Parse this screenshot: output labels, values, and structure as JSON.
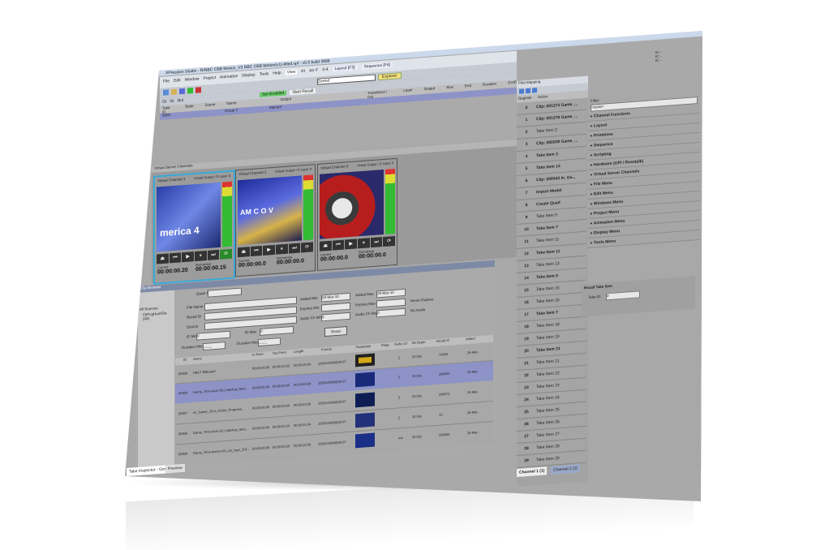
{
  "window": {
    "title": "XPression Studio - R/NBC CBB Motion_V3 NBC CBB Motion(v1)-titled.xpf - v5.5 build 3999",
    "controls": [
      "–",
      "□",
      "✕"
    ]
  },
  "menu": [
    "File",
    "Edit",
    "Window",
    "Project",
    "Animation",
    "Display",
    "Tools",
    "Help"
  ],
  "topbar": {
    "view_tabs": [
      "View",
      "Kt",
      "Arr F",
      "3-4"
    ],
    "layout_tab": "Layout [F3]",
    "sequence_tab": "Sequence [F4]",
    "scene_select": "Zeend",
    "explorer_button": "Explorer",
    "right_labels": [
      "IC -",
      "IC -",
      "IC -"
    ]
  },
  "sequencer": {
    "toolbar_labels": [
      "Gt",
      "Gt",
      "Dul",
      "Set Enabled",
      "Start Recall"
    ],
    "columns": [
      "Take ID",
      "State",
      "Scene",
      "Name",
      "Output",
      "Transitions / Out",
      "Layer",
      "Output",
      "Size",
      "End",
      "Duration",
      "GVID"
    ],
    "extra_label": "entries: 0",
    "rows": [
      {
        "id": "0000",
        "name": "Group 1",
        "output": "Manual"
      }
    ]
  },
  "virtual_channels": {
    "header": "Virtual Server Channels",
    "channels": [
      {
        "name": "Virtual Channel 1",
        "output": "Virtual Output I D Layer 0",
        "current_label": "Current",
        "current": "00:00:00.20",
        "remaining_label": "Remaining",
        "remaining": "00:00:00.15",
        "video_text": "merica 4"
      },
      {
        "name": "Virtual Channel 2",
        "output": "Virtual Output I D Layer 0",
        "current_label": "Current",
        "current": "00:00:00.0",
        "remaining_label": "Remaining",
        "remaining": "00:00:00.0",
        "video_text": "AM C O V"
      },
      {
        "name": "Virtual Channel 3",
        "output": "Virtual Output I D Layer 0",
        "current_label": "Current",
        "current": "00:00:00.0",
        "remaining_label": "Remaining",
        "remaining": "00:00:00.0",
        "video_text": ""
      }
    ]
  },
  "clip_browser": {
    "header": "Clip Browser",
    "tree": [
      "All Sources",
      "CliPcgHumFile (All)"
    ],
    "quick_find_label": "Quick Find",
    "filters": {
      "file_name": "File Name",
      "recall_id": "Recall ID",
      "source": "Source",
      "id_min": "ID Min",
      "id_max": "ID Max",
      "duration_min": "Duration Min",
      "duration_max": "Duration Max",
      "added_min": "Added Min",
      "added_min_val": "03-Mar-10",
      "added_max": "Added Max",
      "added_max_val": "28-Mar-10",
      "expires_min": "Expires Min",
      "expires_max": "Expires Max",
      "audio_ch_min": "Audio Ch Min",
      "audio_ch_max": "Audio Ch Max",
      "never_expires": "Never Expires",
      "no_audio": "No Audio",
      "reset": "Reset",
      "id_min_val": "0",
      "id_max_val": "0",
      "duration_placeholder": "_:_:_"
    },
    "columns": [
      "ID",
      "Name",
      "In Point",
      "Out Point",
      "Length",
      "Format",
      "Thumbnail",
      "Flags",
      "Audio Ch",
      "Bit Depth",
      "Recall ID",
      "Added"
    ],
    "rows": [
      {
        "id": "00008",
        "name": "NBCT Billboard",
        "in": "00:00:00.00",
        "out": "00:00:10.03",
        "len": "00:00:10.04",
        "fmt": "1920x1080i@29.97",
        "flags": "",
        "audio": "2",
        "depth": "32 bits",
        "recall": "74000",
        "added": "26-Mar-"
      },
      {
        "id": "00009",
        "name": "Game_Time-louis-03_matchup_Mov...",
        "in": "00:00:00.00",
        "out": "00:00:03.00",
        "len": "00:00:03.00",
        "fmt": "1920x1080i@29.97",
        "flags": "",
        "audio": "2",
        "depth": "32 bits",
        "recall": "200304",
        "added": "26-Mar-"
      },
      {
        "id": "00007",
        "name": "Im_Game_2014_Kickin_Progress...",
        "in": "00:00:00.00",
        "out": "00:00:03.00",
        "len": "00:00:03.00",
        "fmt": "1920x1080i@29.97",
        "flags": "",
        "audio": "2",
        "depth": "32 bits",
        "recall": "206573",
        "added": "26-Mar-"
      },
      {
        "id": "00008",
        "name": "Game_Time-louis-03_matchup_Mov...",
        "in": "00:00:00.00",
        "out": "00:00:01.04",
        "len": "00:00:01.04",
        "fmt": "1920x1080i@29.97",
        "flags": "",
        "audio": "2",
        "depth": "32 bits",
        "recall": "12",
        "added": "26-Mar-"
      },
      {
        "id": "00009",
        "name": "Game_Time-lesson-03_LG_logo_201...",
        "in": "00:00:00.00",
        "out": "00:00:09.29",
        "len": "00:00:10.00",
        "fmt": "1920x1080i@29.97",
        "flags": "",
        "audio": "n/a",
        "depth": "32 bits",
        "recall": "200566",
        "added": "26-Mar-"
      }
    ]
  },
  "bottom_tabs": [
    "Take Inspector - Group",
    "Preview"
  ],
  "pilot_mapping": {
    "header": "Pilot Mapping",
    "columns": [
      "Register",
      "Action"
    ],
    "items": [
      {
        "n": "0",
        "t": "Clip: 001274 Game_...",
        "b": true
      },
      {
        "n": "1",
        "t": "Clip: 001276 Game_...",
        "b": true
      },
      {
        "n": "2",
        "t": "Take Item 2",
        "b": false
      },
      {
        "n": "3",
        "t": "Clip: 000039 Game_...",
        "b": true
      },
      {
        "n": "4",
        "t": "Take Item 3",
        "b": true
      },
      {
        "n": "5",
        "t": "Take Item 14",
        "b": true
      },
      {
        "n": "6",
        "t": "Clip: 000043 In_Ga...",
        "b": true
      },
      {
        "n": "7",
        "t": "Import Model",
        "b": true
      },
      {
        "n": "8",
        "t": "Create Quad",
        "b": true
      },
      {
        "n": "9",
        "t": "Take Item 9",
        "b": false
      },
      {
        "n": "10",
        "t": "Take Item 7",
        "b": true
      },
      {
        "n": "11",
        "t": "Take Item 11",
        "b": false
      },
      {
        "n": "12",
        "t": "Take Item 11",
        "b": true
      },
      {
        "n": "13",
        "t": "Take Item 13",
        "b": false
      },
      {
        "n": "14",
        "t": "Take Item 5",
        "b": true
      },
      {
        "n": "15",
        "t": "Take Item 15",
        "b": false
      },
      {
        "n": "16",
        "t": "Take Item 16",
        "b": false
      },
      {
        "n": "17",
        "t": "Take Item 7",
        "b": true
      },
      {
        "n": "18",
        "t": "Take Item 18",
        "b": false
      },
      {
        "n": "19",
        "t": "Take Item 19",
        "b": false
      },
      {
        "n": "20",
        "t": "Take Item 21",
        "b": true
      },
      {
        "n": "21",
        "t": "Take Item 21",
        "b": false
      },
      {
        "n": "22",
        "t": "Take Item 22",
        "b": false
      },
      {
        "n": "23",
        "t": "Take Item 23",
        "b": false
      },
      {
        "n": "24",
        "t": "Take Item 24",
        "b": false
      },
      {
        "n": "25",
        "t": "Take Item 25",
        "b": false
      },
      {
        "n": "26",
        "t": "Take Item 26",
        "b": false
      },
      {
        "n": "27",
        "t": "Take Item 27",
        "b": false
      },
      {
        "n": "28",
        "t": "Take Item 28",
        "b": false
      },
      {
        "n": "29",
        "t": "Take Item 29",
        "b": false
      }
    ],
    "channel_tabs": [
      "Channel 1 (1)",
      "Channel 2 (2)"
    ]
  },
  "functions": {
    "filter_label": "Filter:",
    "filter_placeholder": "<none>",
    "groups": [
      "Channel Functions",
      "Layout",
      "Primitives",
      "Sequence",
      "Scripting",
      "Hardware (GPI / Rosstalk)",
      "Virtual Server Channels",
      "File Menu",
      "Edit Menu",
      "Windows Menu",
      "Project Menu",
      "Animation Menu",
      "Display Menu",
      "Tools Menu"
    ],
    "recall_header": "Recall Take Item",
    "take_id_label": "Take ID:",
    "take_id_value": "0"
  },
  "colors": {
    "panel_header": "#7d8aa6",
    "selected_row": "#8d93c7",
    "channel_highlight": "#3aa9d8",
    "window_bg": "#a9a9a9"
  }
}
